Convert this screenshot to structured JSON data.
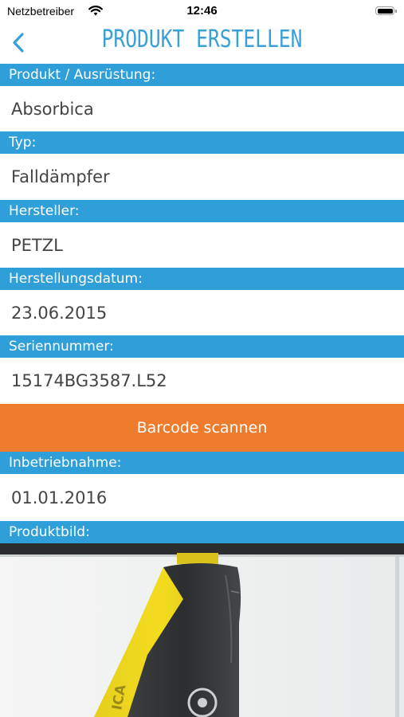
{
  "status_bar": {
    "carrier": "Netzbetreiber",
    "time": "12:46"
  },
  "nav": {
    "title": "PRODUKT ERSTELLEN"
  },
  "fields": [
    {
      "label": "Produkt / Ausrüstung:",
      "value": "Absorbica"
    },
    {
      "label": "Typ:",
      "value": "Falldämpfer"
    },
    {
      "label": "Hersteller:",
      "value": "PETZL"
    },
    {
      "label": "Herstellungsdatum:",
      "value": "23.06.2015"
    },
    {
      "label": "Seriennummer:",
      "value": "15174BG3587.L52"
    }
  ],
  "scan_button": {
    "label": "Barcode scannen"
  },
  "commissioning": {
    "label": "Inbetriebnahme:",
    "value": "01.01.2016"
  },
  "product_image": {
    "label": "Produktbild:",
    "print_text": "ICA"
  },
  "colors": {
    "accent_blue": "#2e9fd8",
    "title_blue": "#3aa0d8",
    "scan_orange": "#ef7b2d"
  }
}
